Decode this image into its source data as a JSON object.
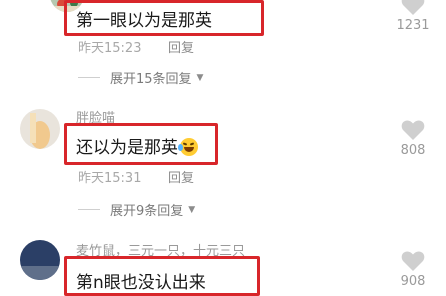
{
  "comments": [
    {
      "username": "",
      "content": "第一眼以为是那英",
      "timestamp": "昨天15:23",
      "reply_label": "回复",
      "expand_label": "展开15条回复",
      "like_count": "1231"
    },
    {
      "username": "胖脸喵",
      "content": "还以为是那英",
      "emoji": "rolling-laughing-emoji",
      "timestamp": "昨天15:31",
      "reply_label": "回复",
      "expand_label": "展开9条回复",
      "like_count": "808"
    },
    {
      "username": "麦竹鼠，三元一只，十元三只",
      "content": "第n眼也没认出来",
      "like_count": "908"
    }
  ],
  "colors": {
    "highlight_border": "#d8262a",
    "text_primary": "#1a1a1a",
    "text_secondary": "#9a9a9a"
  }
}
